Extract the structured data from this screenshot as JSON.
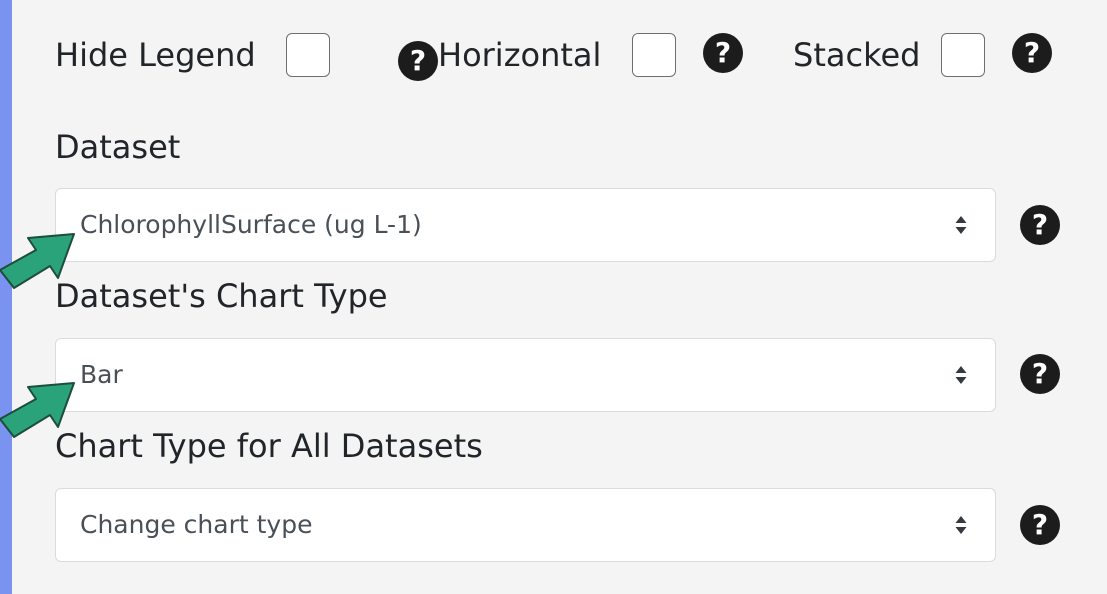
{
  "options": {
    "hide_legend_label": "Hide Legend",
    "horizontal_label": "Horizontal",
    "stacked_label": "Stacked"
  },
  "dataset": {
    "label": "Dataset",
    "value": "ChlorophyllSurface (ug L-1)"
  },
  "dataset_chart_type": {
    "label": "Dataset's Chart Type",
    "value": "Bar"
  },
  "all_chart_type": {
    "label": "Chart Type for All Datasets",
    "value": "Change chart type"
  },
  "help": {
    "glyph": "?"
  },
  "colors": {
    "background_frame": "#7b93f0",
    "panel": "#f4f4f4",
    "annotation_arrow": "#2aa37a"
  }
}
